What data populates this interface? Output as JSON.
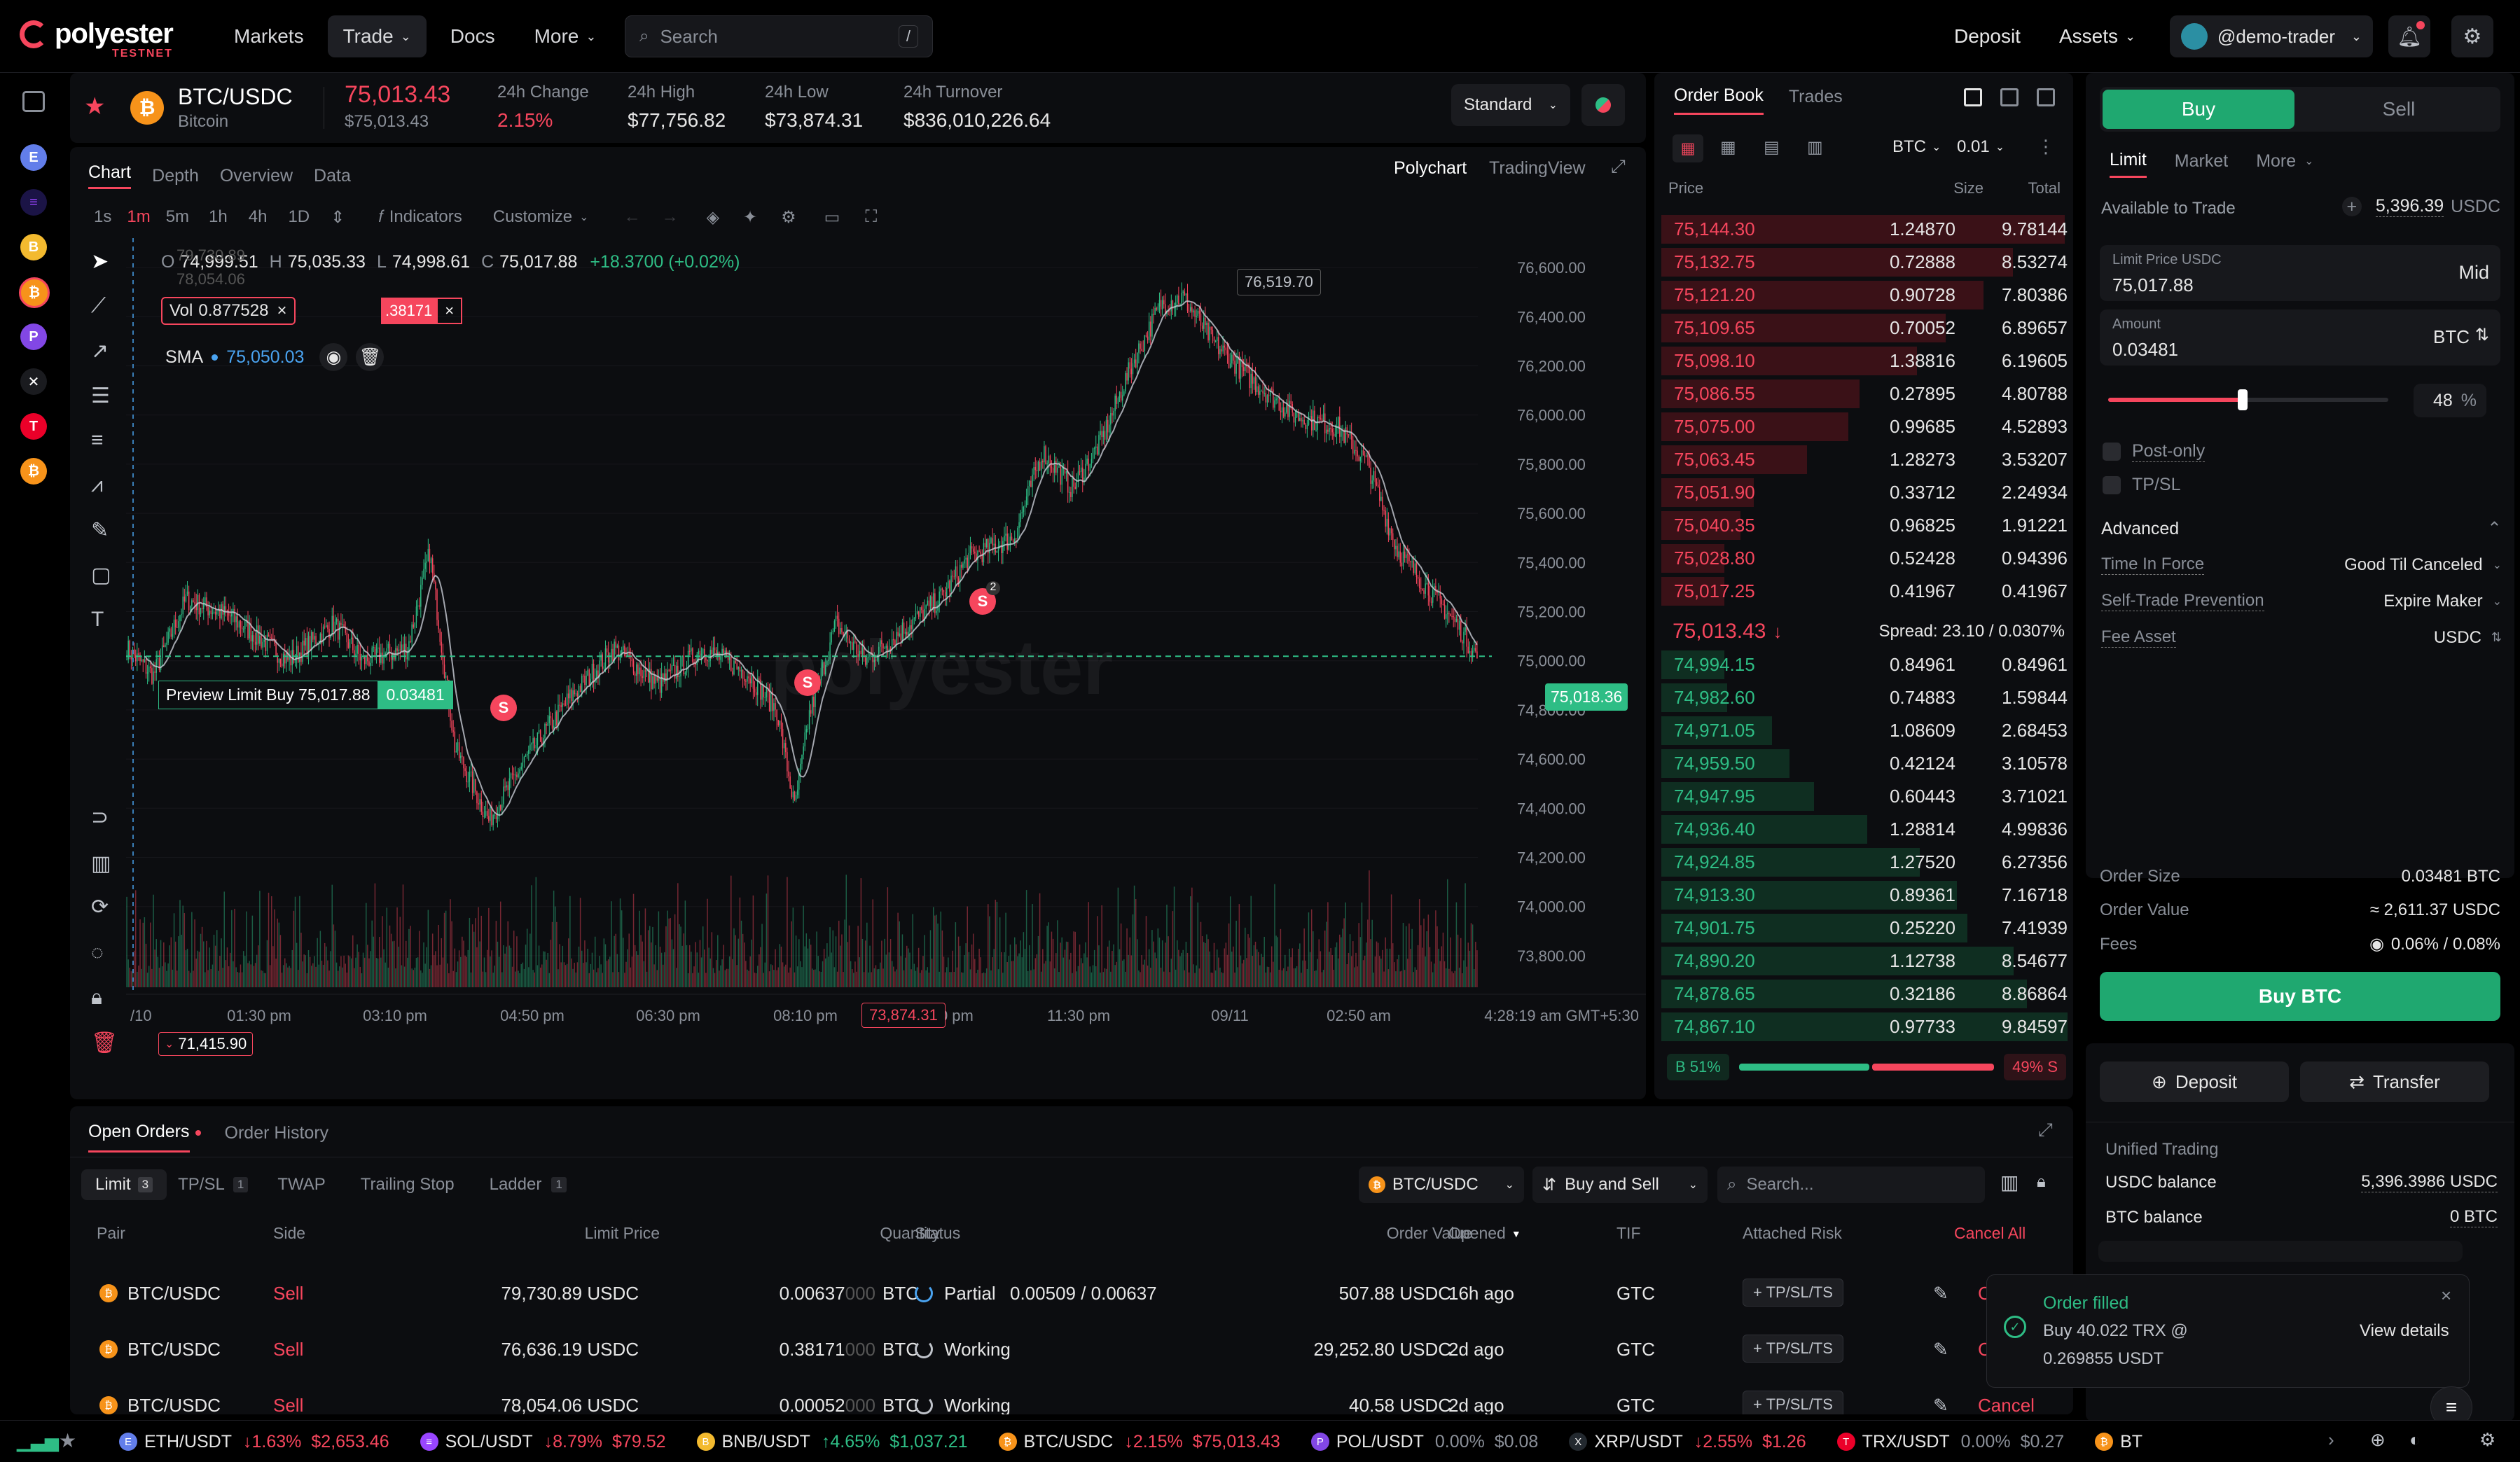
{
  "brand": {
    "name": "polyester",
    "sub": "TESTNET"
  },
  "nav": {
    "markets": "Markets",
    "trade": "Trade",
    "docs": "Docs",
    "more": "More",
    "search_placeholder": "Search",
    "search_key": "/",
    "deposit": "Deposit",
    "assets": "Assets",
    "user": "@demo-trader"
  },
  "ticker": {
    "pair": "BTC/USDC",
    "name": "Bitcoin",
    "price": "75,013.43",
    "price_sub": "$75,013.43",
    "change_label": "24h Change",
    "change": "2.15%",
    "high_label": "24h High",
    "high": "$77,756.82",
    "low_label": "24h Low",
    "low": "$73,874.31",
    "turnover_label": "24h Turnover",
    "turnover": "$836,010,226.64",
    "mode": "Standard"
  },
  "chart_tabs": [
    "Chart",
    "Depth",
    "Overview",
    "Data"
  ],
  "chart_src": {
    "poly": "Polychart",
    "tv": "TradingView"
  },
  "toolbar": {
    "intervals": [
      "1s",
      "1m",
      "5m",
      "1h",
      "4h",
      "1D"
    ],
    "indicators": "Indicators",
    "customize": "Customize"
  },
  "ohlc": {
    "o_label": "O",
    "o": "74,999.51",
    "h_label": "H",
    "h": "75,035.33",
    "l_label": "L",
    "l": "74,998.61",
    "c_label": "C",
    "c": "75,017.88",
    "chg": "+18.3700 (+0.02%)"
  },
  "overlays": {
    "ghost1": "79,730.89",
    "ghost2": "78,054.06",
    "vol_label": "Vol",
    "vol": "0.87752​8",
    "red_tag": ".38171",
    "sma_label": "SMA",
    "sma": "75,050.03",
    "preview": "Preview Limit Buy 75,017.88",
    "preview_qty": "0.03481",
    "last_price": "75,018.36",
    "high_mark": "76,519.70",
    "low_mark": "73,874.31",
    "low_left": "71,415.90",
    "s_marker": "S",
    "s2_count": "2",
    "watermark": "polyester"
  },
  "y_ticks": [
    "76,600.00",
    "76,400.00",
    "76,200.00",
    "76,000.00",
    "75,800.00",
    "75,600.00",
    "75,400.00",
    "75,200.00",
    "75,000.00",
    "74,800.00",
    "74,600.00",
    "74,400.00",
    "74,200.00",
    "74,000.00",
    "73,800.00"
  ],
  "x_ticks": [
    "/10",
    "01:30 pm",
    "03:10 pm",
    "04:50 pm",
    "06:30 pm",
    "08:10 pm",
    "09:50 pm",
    "11:30 pm",
    "09/11",
    "02:50 am"
  ],
  "x_time": "4:28:19 am GMT+5:30",
  "orderbook": {
    "tab_book": "Order Book",
    "tab_trades": "Trades",
    "unit": "BTC",
    "step": "0.01",
    "col_price": "Price",
    "col_size": "Size",
    "col_total": "Total",
    "asks": [
      [
        "75,144.30",
        "1.24870",
        "9.78144"
      ],
      [
        "75,132.75",
        "0.72888",
        "8.53274"
      ],
      [
        "75,121.20",
        "0.90728",
        "7.80386"
      ],
      [
        "75,109.65",
        "0.70052",
        "6.89657"
      ],
      [
        "75,098.10",
        "1.38816",
        "6.19605"
      ],
      [
        "75,086.55",
        "0.27895",
        "4.80788"
      ],
      [
        "75,075.00",
        "0.99685",
        "4.52893"
      ],
      [
        "75,063.45",
        "1.28273",
        "3.53207"
      ],
      [
        "75,051.90",
        "0.33712",
        "2.24934"
      ],
      [
        "75,040.35",
        "0.96825",
        "1.91221"
      ],
      [
        "75,028.80",
        "0.52428",
        "0.94396"
      ],
      [
        "75,017.25",
        "0.41967",
        "0.41967"
      ]
    ],
    "mid": "75,013.43",
    "mid_arrow": "↓",
    "spread": "Spread: 23.10 / 0.0307%",
    "bids": [
      [
        "74,994.15",
        "0.84961",
        "0.84961"
      ],
      [
        "74,982.60",
        "0.74883",
        "1.59844"
      ],
      [
        "74,971.05",
        "1.08609",
        "2.68453"
      ],
      [
        "74,959.50",
        "0.42124",
        "3.10578"
      ],
      [
        "74,947.95",
        "0.60443",
        "3.71021"
      ],
      [
        "74,936.40",
        "1.28814",
        "4.99836"
      ],
      [
        "74,924.85",
        "1.27520",
        "6.27356"
      ],
      [
        "74,913.30",
        "0.89361",
        "7.16718"
      ],
      [
        "74,901.75",
        "0.25220",
        "7.41939"
      ],
      [
        "74,890.20",
        "1.12738",
        "8.54677"
      ],
      [
        "74,878.65",
        "0.32186",
        "8.86864"
      ],
      [
        "74,867.10",
        "0.97733",
        "9.84597"
      ]
    ],
    "buy_pct": "B 51%",
    "sell_pct": "49% S"
  },
  "order": {
    "buy": "Buy",
    "sell": "Sell",
    "tabs": [
      "Limit",
      "Market",
      "More"
    ],
    "avail_label": "Available to Trade",
    "avail": "5,396.39",
    "avail_unit": "USDC",
    "limit_label": "Limit Price USDC",
    "limit_val": "75,017.88",
    "mid": "Mid",
    "amount_label": "Amount",
    "amount_val": "0.03481",
    "amount_unit": "BTC",
    "pct": "48",
    "pct_sign": "%",
    "post_only": "Post-only",
    "tpsl": "TP/SL",
    "advanced": "Advanced",
    "tif_label": "Time In Force",
    "tif": "Good Til Canceled",
    "stp_label": "Self-Trade Prevention",
    "stp": "Expire Maker",
    "fee_asset_label": "Fee Asset",
    "fee_asset": "USDC",
    "size_label": "Order Size",
    "size": "0.03481 BTC",
    "value_label": "Order Value",
    "value": "≈ 2,611.37 USDC",
    "fees_label": "Fees",
    "fees": "0.06% / 0.08%",
    "submit": "Buy BTC",
    "deposit": "Deposit",
    "transfer": "Transfer",
    "unified": "Unified Trading",
    "usdc_bal_label": "USDC balance",
    "usdc_bal": "5,396.3986 USDC",
    "btc_bal_label": "BTC balance",
    "btc_bal": "0 BTC"
  },
  "orders": {
    "tab_open": "Open Orders",
    "tab_hist": "Order History",
    "sub": [
      "Limit",
      "TP/SL",
      "TWAP",
      "Trailing Stop",
      "Ladder"
    ],
    "sub_counts": [
      "3",
      "1",
      "",
      "",
      "1"
    ],
    "pair_filter": "BTC/USDC",
    "side_filter": "Buy and Sell",
    "search": "Search...",
    "cols": [
      "Pair",
      "Side",
      "Limit Price",
      "Quantity",
      "Status",
      "Order Value",
      "Opened",
      "TIF",
      "Attached Risk",
      "Cancel All"
    ],
    "rows": [
      {
        "pair": "BTC/USDC",
        "side": "Sell",
        "price": "79,730.89 USDC",
        "qty": "0.00637",
        "qty_pad": "000",
        "unit": "BTC",
        "status": "Partial",
        "fill": "0.00509 / 0.00637",
        "value": "507.88 USDC",
        "opened": "16h ago",
        "tif": "GTC",
        "risk": "+ TP/SL/TS",
        "cancel": "C"
      },
      {
        "pair": "BTC/USDC",
        "side": "Sell",
        "price": "76,636.19 USDC",
        "qty": "0.38171",
        "qty_pad": "000",
        "unit": "BTC",
        "status": "Working",
        "fill": "",
        "value": "29,252.80 USDC",
        "opened": "2d ago",
        "tif": "GTC",
        "risk": "+ TP/SL/TS",
        "cancel": "C"
      },
      {
        "pair": "BTC/USDC",
        "side": "Sell",
        "price": "78,054.06 USDC",
        "qty": "0.00052",
        "qty_pad": "000",
        "unit": "BTC",
        "status": "Working",
        "fill": "",
        "value": "40.58 USDC",
        "opened": "2d ago",
        "tif": "GTC",
        "risk": "+ TP/SL/TS",
        "cancel": "Cancel"
      }
    ]
  },
  "toast": {
    "title": "Order filled",
    "body": "Buy 40.022 TRX @",
    "price": "0.269855 USDT",
    "action": "View details"
  },
  "bottom_tickers": [
    {
      "pair": "ETH/USDT",
      "chg": "↓1.63%",
      "price": "$2,653.46",
      "c": "#f6465d",
      "coin": "#627eea",
      "sym": "E"
    },
    {
      "pair": "SOL/USDT",
      "chg": "↓8.79%",
      "price": "$79.52",
      "c": "#f6465d",
      "coin": "#9945ff",
      "sym": "≡"
    },
    {
      "pair": "BNB/USDT",
      "chg": "↑4.65%",
      "price": "$1,037.21",
      "c": "#2ebd85",
      "coin": "#f3ba2f",
      "sym": "B"
    },
    {
      "pair": "BTC/USDC",
      "chg": "↓2.15%",
      "price": "$75,013.43",
      "c": "#f6465d",
      "coin": "#f7931a",
      "sym": "₿"
    },
    {
      "pair": "POL/USDT",
      "chg": "0.00%",
      "price": "$0.08",
      "c": "#8a8f98",
      "coin": "#8247e5",
      "sym": "P"
    },
    {
      "pair": "XRP/USDT",
      "chg": "↓2.55%",
      "price": "$1.26",
      "c": "#f6465d",
      "coin": "#23292f",
      "sym": "X"
    },
    {
      "pair": "TRX/USDT",
      "chg": "0.00%",
      "price": "$0.27",
      "c": "#8a8f98",
      "coin": "#eb0029",
      "sym": "T"
    },
    {
      "pair": "BT",
      "chg": "",
      "price": "",
      "c": "#8a8f98",
      "coin": "#f7931a",
      "sym": "₿"
    }
  ],
  "colors": {
    "green": "#2ebd85",
    "red": "#f6465d",
    "buy_btn": "#1fa870"
  },
  "chart_data": {
    "type": "candlestick",
    "ylim": [
      73700,
      76720
    ],
    "last_price": 75018.36,
    "high": 76519.7,
    "low": 73874.31
  }
}
